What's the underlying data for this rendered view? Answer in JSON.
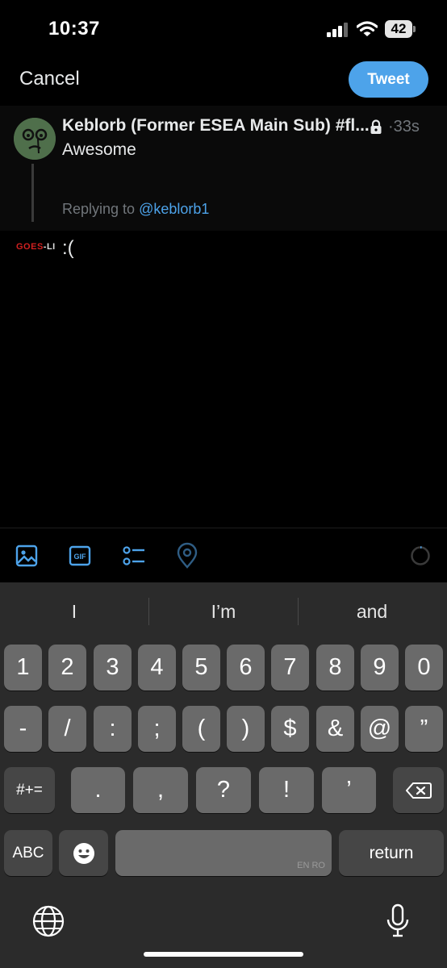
{
  "status_bar": {
    "time": "10:37",
    "battery": "42"
  },
  "top_bar": {
    "cancel_label": "Cancel",
    "tweet_label": "Tweet"
  },
  "replied_tweet": {
    "author": "Keblorb (Former ESEA Main Sub) #fl...",
    "time": "33s",
    "text": "Awesome",
    "replying_prefix": "Replying to",
    "replying_handle": "@keblorb1"
  },
  "compose": {
    "avatar_text": "GOES",
    "avatar_suffix": "-LI",
    "text": ":("
  },
  "toolbar": {
    "icons": [
      "image-icon",
      "gif-icon",
      "poll-icon",
      "location-icon"
    ],
    "gif_label": "GIF"
  },
  "keyboard": {
    "suggestions": [
      "I",
      "I’m",
      "and"
    ],
    "row1": [
      "1",
      "2",
      "3",
      "4",
      "5",
      "6",
      "7",
      "8",
      "9",
      "0"
    ],
    "row2": [
      "-",
      "/",
      ":",
      ";",
      "(",
      ")",
      "$",
      "&",
      "@",
      "”"
    ],
    "row3_left": "#+=",
    "row3": [
      ".",
      ",",
      "?",
      "!",
      "’"
    ],
    "row4_left": "ABC",
    "space_hint": "EN RO",
    "return_label": "return"
  },
  "colors": {
    "accent": "#4da3ea",
    "background": "#000000",
    "keyboard": "#2b2b2b"
  }
}
